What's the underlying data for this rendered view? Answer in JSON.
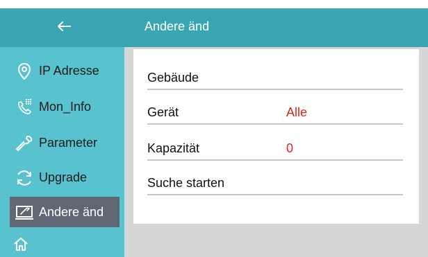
{
  "header": {
    "title": "Andere änd"
  },
  "sidebar": {
    "items": [
      {
        "label": "IP Adresse",
        "icon": "location-pin-icon"
      },
      {
        "label": "Mon_Info",
        "icon": "phone-keypad-icon"
      },
      {
        "label": "Parameter",
        "icon": "wrench-icon"
      },
      {
        "label": "Upgrade",
        "icon": "refresh-icon"
      },
      {
        "label": "Andere änd",
        "icon": "monitor-wrench-icon",
        "active": true
      }
    ]
  },
  "settings": {
    "rows": [
      {
        "label": "Gebäude",
        "value": ""
      },
      {
        "label": "Gerät",
        "value": "Alle"
      },
      {
        "label": "Kapazität",
        "value": "0"
      },
      {
        "label": "Suche starten",
        "value": ""
      }
    ]
  },
  "colors": {
    "header": "#3aa6b3",
    "sidebar": "#58c3ce",
    "active_item": "#5f6872",
    "value_red": "#d9261c",
    "content_bg": "#d6d6d6"
  }
}
